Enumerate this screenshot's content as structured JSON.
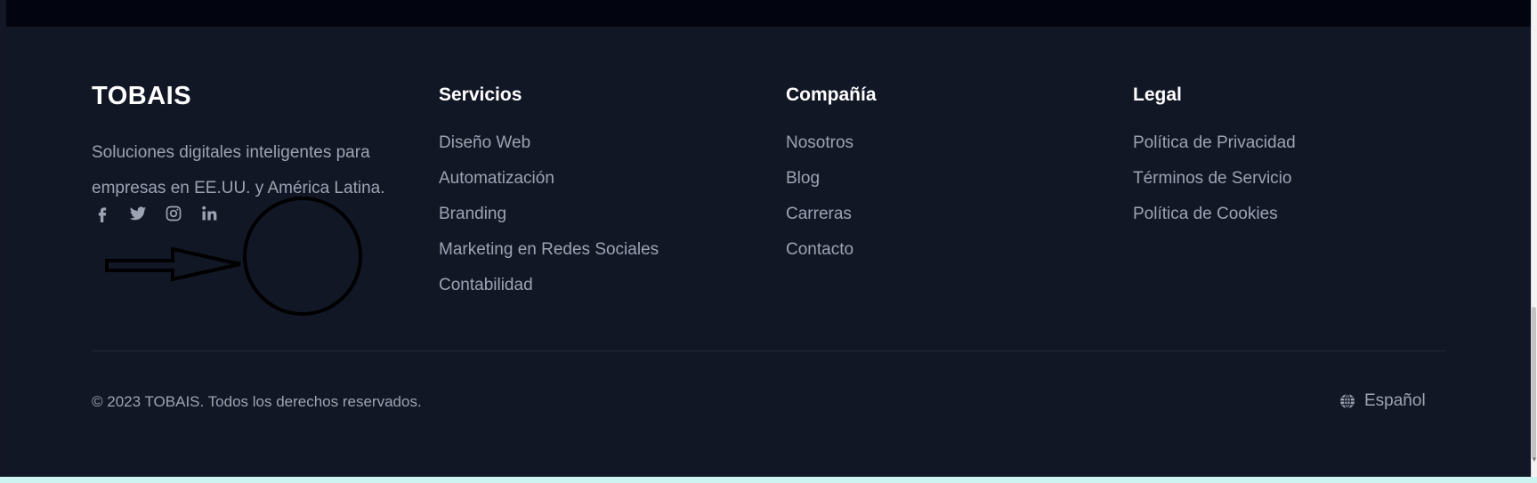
{
  "brand": {
    "name": "TOBAIS",
    "tagline": "Soluciones digitales inteligentes para empresas en EE.UU. y América Latina."
  },
  "social_links": [
    {
      "icon": "facebook-icon"
    },
    {
      "icon": "twitter-icon"
    },
    {
      "icon": "instagram-icon"
    },
    {
      "icon": "linkedin-icon"
    }
  ],
  "columns": {
    "servicios": {
      "title": "Servicios",
      "items": [
        "Diseño Web",
        "Automatización",
        "Branding",
        "Marketing en Redes Sociales",
        "Contabilidad"
      ]
    },
    "compania": {
      "title": "Compañía",
      "items": [
        "Nosotros",
        "Blog",
        "Carreras",
        "Contacto"
      ]
    },
    "legal": {
      "title": "Legal",
      "items": [
        "Política de Privacidad",
        "Términos de Servicio",
        "Política de Cookies"
      ]
    }
  },
  "bottom": {
    "copyright": "© 2023 TOBAIS. Todos los derechos reservados.",
    "language_icon": "globe-icon",
    "language": "Español"
  },
  "annotation": {
    "shapes": [
      "arrow-icon",
      "circle-icon"
    ],
    "color": "#000000"
  },
  "colors": {
    "background": "#121726",
    "top_strip": "#02050f",
    "heading": "#ffffff",
    "muted_text": "#9ca3b2",
    "divider": "#252b3a"
  }
}
